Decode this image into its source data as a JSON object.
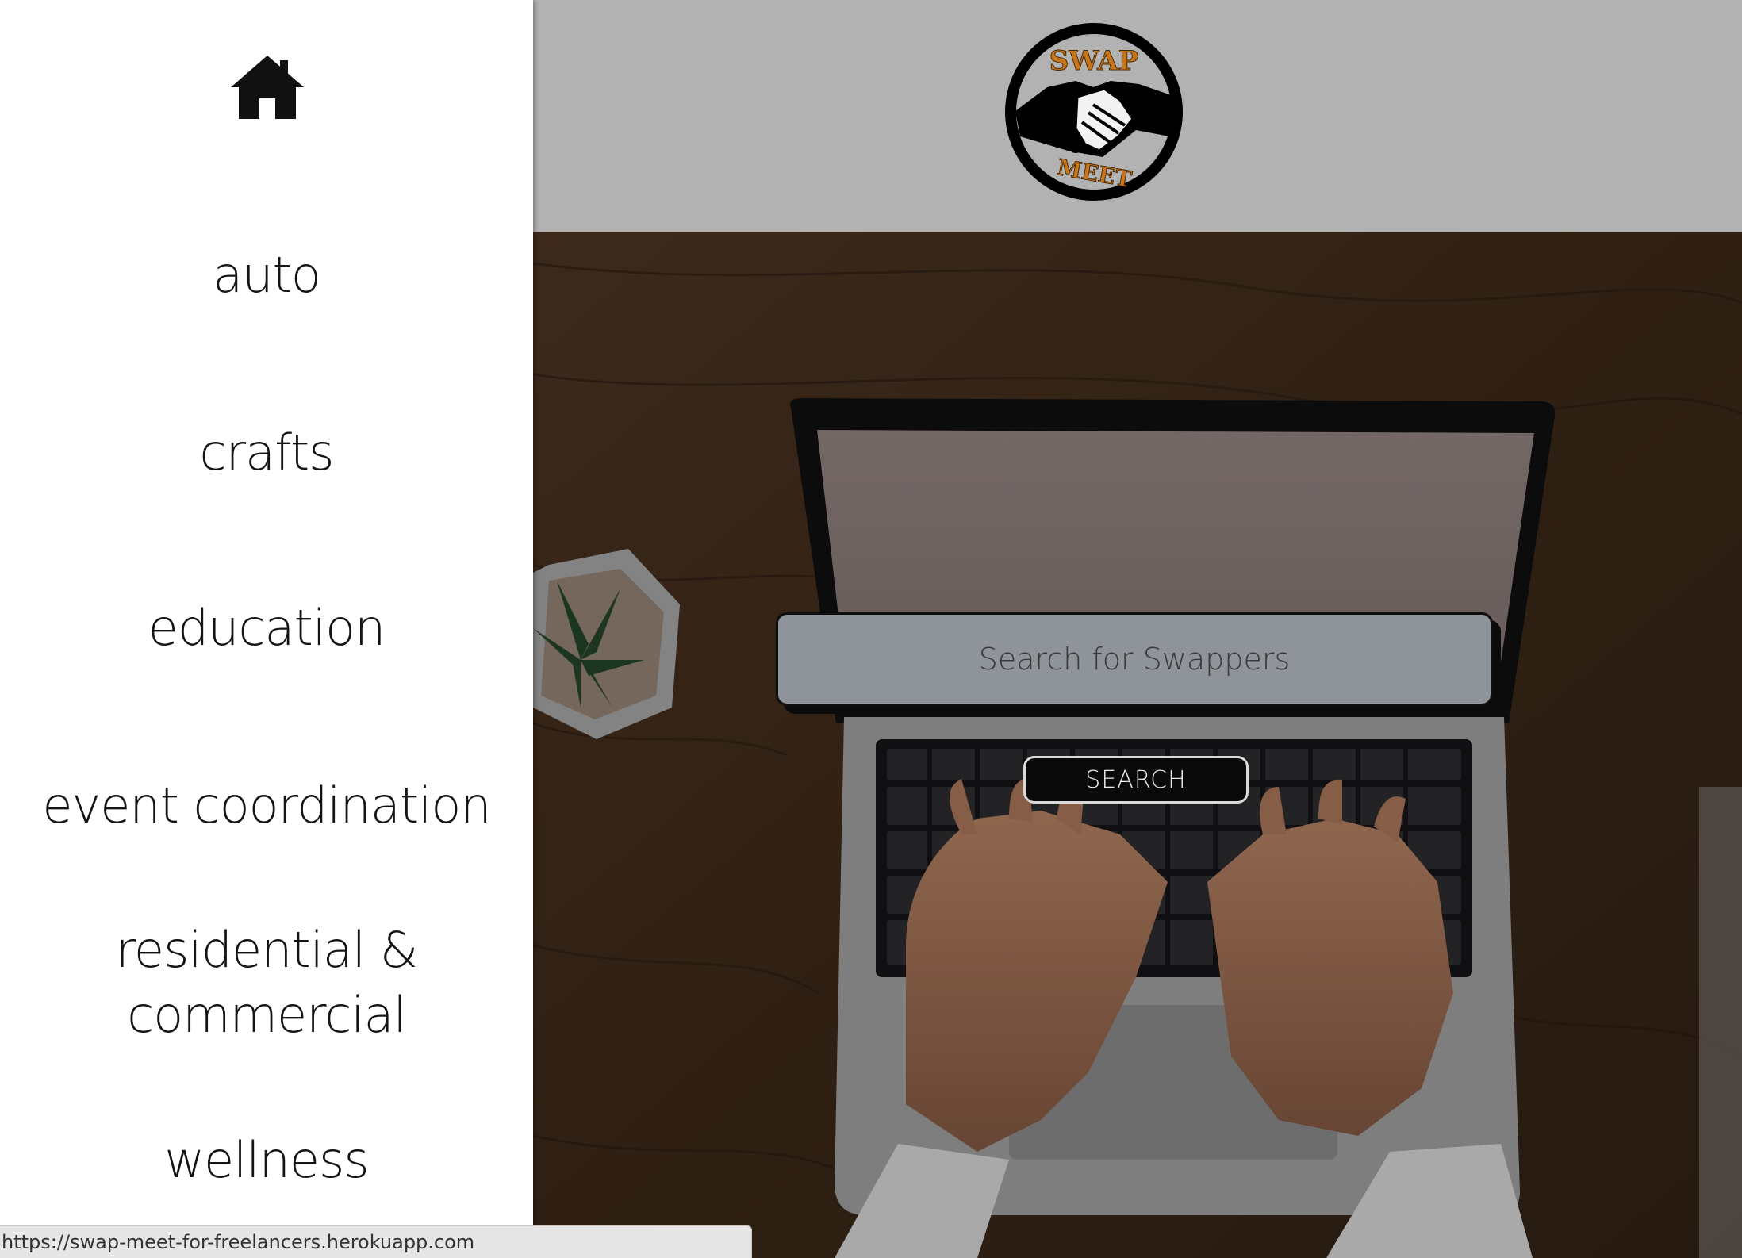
{
  "sidebar": {
    "home_icon": "home-icon",
    "categories": [
      {
        "label": "auto"
      },
      {
        "label": "crafts"
      },
      {
        "label": "education"
      },
      {
        "label": "event coordination"
      },
      {
        "label_line1": "residential &",
        "label_line2": "commercial"
      },
      {
        "label": "wellness"
      }
    ]
  },
  "header": {
    "logo": {
      "top_text": "SWAP",
      "bottom_text": "MEET",
      "icon": "handshake-icon",
      "accent_color": "#c8761c"
    },
    "background_color": "#b2b2b2"
  },
  "search": {
    "placeholder": "Search for Swappers",
    "value": "",
    "button_label": "SEARCH"
  },
  "status_bar": {
    "url": "https://swap-meet-for-freelancers.herokuapp.com"
  }
}
